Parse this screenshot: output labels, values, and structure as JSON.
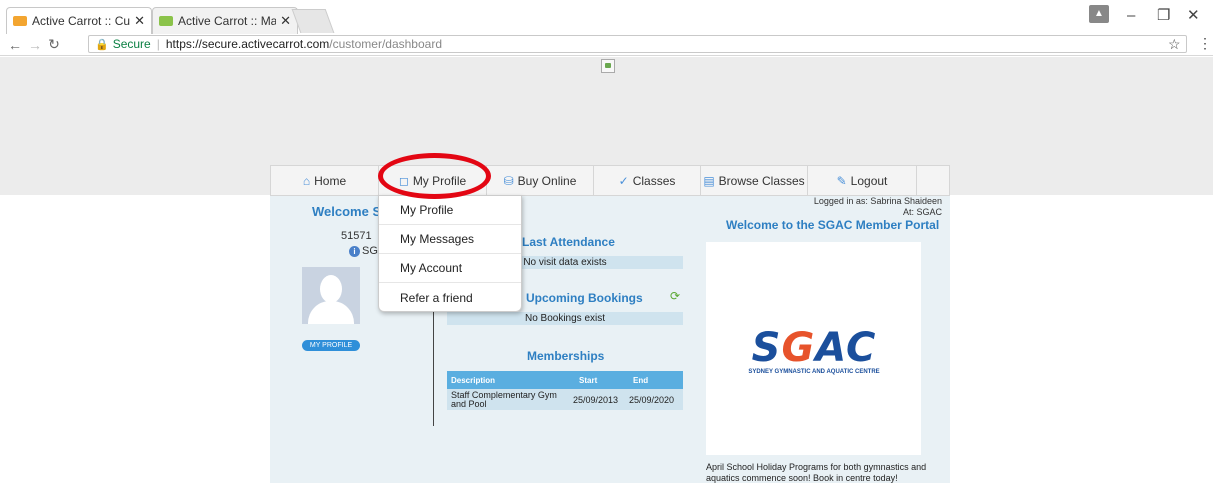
{
  "browser": {
    "tabs": [
      {
        "title": "Active Carrot :: Customer",
        "active": true
      },
      {
        "title": "Active Carrot :: Manager",
        "active": false
      }
    ],
    "security_label": "Secure",
    "url_host": "https://secure.activecarrot.com",
    "url_path": "/customer/dashboard"
  },
  "nav": {
    "items": [
      {
        "label": "Home",
        "icon": "home-icon"
      },
      {
        "label": "My Profile",
        "icon": "lock-icon"
      },
      {
        "label": "Buy Online",
        "icon": "cart-icon"
      },
      {
        "label": "Classes",
        "icon": "check-icon"
      },
      {
        "label": "Browse Classes",
        "icon": "list-icon"
      },
      {
        "label": "Logout",
        "icon": "logout-icon"
      }
    ]
  },
  "dropdown": {
    "items": [
      "My Profile",
      "My Messages",
      "My Account",
      "Refer a friend"
    ]
  },
  "left": {
    "welcome": "Welcome Sa",
    "member_id": "51571",
    "venue": "SG/",
    "profile_button": "MY PROFILE"
  },
  "middle": {
    "last_attendance_title": "Last Attendance",
    "last_attendance_empty": "No visit data exists",
    "upcoming_title": "Upcoming Bookings",
    "upcoming_empty": "No Bookings exist",
    "memberships_title": "Memberships",
    "memberships": {
      "headers": [
        "Description",
        "Start",
        "End"
      ],
      "rows": [
        [
          "Staff Complementary Gym and Pool",
          "25/09/2013",
          "25/09/2020"
        ]
      ]
    }
  },
  "right": {
    "logged_in": "Logged in as: Sabrina Shaideen",
    "at": "At: SGAC",
    "welcome": "Welcome to the SGAC Member Portal",
    "logo_text": "SGAC",
    "logo_sub": "SYDNEY GYMNASTIC AND AQUATIC CENTRE",
    "promo": "April School Holiday Programs for both gymnastics and aquatics commence soon! Book in centre today!"
  },
  "colors": {
    "accent": "#2e7fc2",
    "highlight_circle": "#e30613"
  }
}
